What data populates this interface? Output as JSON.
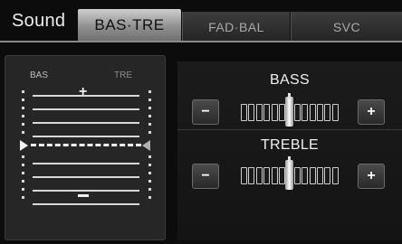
{
  "header": {
    "title": "Sound",
    "tabs": [
      {
        "label": "BAS·TRE",
        "active": true
      },
      {
        "label": "FAD·BAL",
        "active": false
      },
      {
        "label": "SVC",
        "active": false
      }
    ]
  },
  "balance_panel": {
    "bas_label": "BAS",
    "tre_label": "TRE",
    "plus_symbol": "+"
  },
  "bass": {
    "label": "BASS",
    "minus_label": "−",
    "plus_label": "+",
    "level": 0,
    "steps": 13
  },
  "treble": {
    "label": "TREBLE",
    "minus_label": "−",
    "plus_label": "+",
    "level": 0,
    "steps": 13
  }
}
